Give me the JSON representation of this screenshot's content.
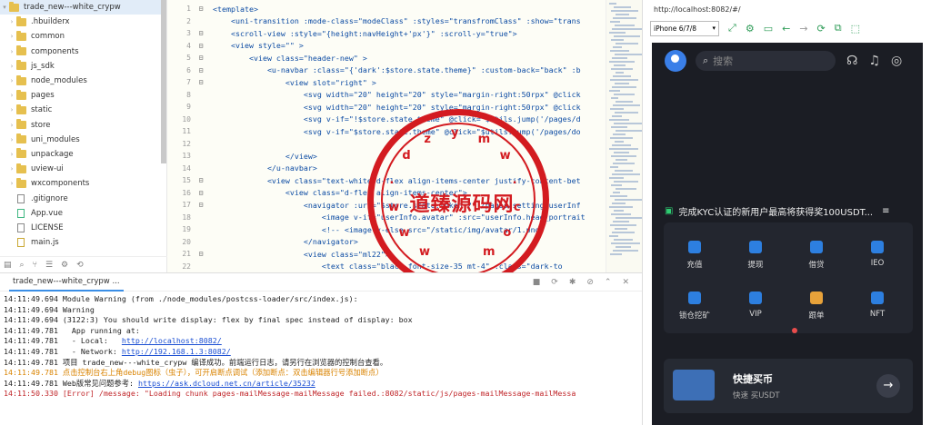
{
  "sidebar": {
    "project": "trade_new---white_crypw",
    "items": [
      {
        "name": ".hbuilderx",
        "type": "folder"
      },
      {
        "name": "common",
        "type": "folder"
      },
      {
        "name": "components",
        "type": "folder"
      },
      {
        "name": "js_sdk",
        "type": "folder"
      },
      {
        "name": "node_modules",
        "type": "folder"
      },
      {
        "name": "pages",
        "type": "folder"
      },
      {
        "name": "static",
        "type": "folder"
      },
      {
        "name": "store",
        "type": "folder"
      },
      {
        "name": "uni_modules",
        "type": "folder"
      },
      {
        "name": "unpackage",
        "type": "folder"
      },
      {
        "name": "uview-ui",
        "type": "folder"
      },
      {
        "name": "wxcomponents",
        "type": "folder"
      },
      {
        "name": ".gitignore",
        "type": "file"
      },
      {
        "name": "App.vue",
        "type": "file"
      },
      {
        "name": "LICENSE",
        "type": "file"
      },
      {
        "name": "main.js",
        "type": "file"
      }
    ]
  },
  "editor": {
    "lines": [
      {
        "n": "1",
        "f": "⊟",
        "t": "<template>"
      },
      {
        "n": "2",
        "f": "",
        "t": "    <uni-transition :mode-class=\"modeClass\" :styles=\"transfromClass\" :show=\"trans"
      },
      {
        "n": "3",
        "f": "⊟",
        "t": "    <scroll-view :style=\"{height:navHeight+'px'}\" :scroll-y=\"true\">"
      },
      {
        "n": "4",
        "f": "⊟",
        "t": "    <view style=\"\" >"
      },
      {
        "n": "5",
        "f": "⊟",
        "t": "        <view class=\"header-new\" >"
      },
      {
        "n": "6",
        "f": "⊟",
        "t": "            <u-navbar :class=\"{'dark':$store.state.theme}\" :custom-back=\"back\" :b"
      },
      {
        "n": "7",
        "f": "⊟",
        "t": "                <view slot=\"right\" >"
      },
      {
        "n": "8",
        "f": "",
        "t": "                    <svg width=\"20\" height=\"20\" style=\"margin-right:50rpx\" @click"
      },
      {
        "n": "9",
        "f": "",
        "t": "                    <svg width=\"20\" height=\"20\" style=\"margin-right:50rpx\" @click"
      },
      {
        "n": "10",
        "f": "",
        "t": "                    <svg v-if=\"!$store.state.theme\" @click=\"$utils.jump('/pages/d"
      },
      {
        "n": "11",
        "f": "",
        "t": "                    <svg v-if=\"$store.state.theme\" @click=\"$utils.jump('/pages/do"
      },
      {
        "n": "12",
        "f": "",
        "t": ""
      },
      {
        "n": "13",
        "f": "",
        "t": "                </view>"
      },
      {
        "n": "14",
        "f": "",
        "t": "            </u-navbar>"
      },
      {
        "n": "15",
        "f": "⊟",
        "t": "            <view class=\"text-white d-flex align-items-center justify-content-bet"
      },
      {
        "n": "16",
        "f": "⊟",
        "t": "                <view class=\"d-flex align-items-center\">"
      },
      {
        "n": "17",
        "f": "⊟",
        "t": "                    <navigator :url=\"$store.state.token ? '/pages/setting/userInf"
      },
      {
        "n": "18",
        "f": "",
        "t": "                        <image v-if=\"userInfo.avatar\" :src=\"userInfo.head_portrait"
      },
      {
        "n": "19",
        "f": "",
        "t": "                        <!-- <image v-else src=\"/static/img/avatar/1.png\""
      },
      {
        "n": "20",
        "f": "",
        "t": "                    </navigator>"
      },
      {
        "n": "21",
        "f": "⊟",
        "t": "                    <view class=\"ml22\">"
      },
      {
        "n": "22",
        "f": "",
        "t": "                        <text class=\"black font-size-35 mt-4\" :class=\"dark-to"
      }
    ]
  },
  "console": {
    "tab_label": "trade_new---white_crypw ...",
    "logs": [
      {
        "t": "14:11:49.694 Module Warning (from ./node_modules/postcss-loader/src/index.js):",
        "k": "n"
      },
      {
        "t": "14:11:49.694 Warning",
        "k": "n"
      },
      {
        "t": "14:11:49.694 (3122:3) You should write display: flex by final spec instead of display: box",
        "k": "n"
      },
      {
        "t": "14:11:49.781   App running at:",
        "k": "n"
      },
      {
        "t": "14:11:49.781   - Local:   ",
        "link": "http://localhost:8082/",
        "k": "l"
      },
      {
        "t": "14:11:49.781   - Network: ",
        "link": "http://192.168.1.3:8082/",
        "k": "l"
      },
      {
        "t": "14:11:49.781 项目 trade_new---white_crypw 编译成功。前端运行日志，请另行在浏览器的控制台查看。",
        "k": "n"
      },
      {
        "t": "14:11:49.781 点击控制台右上角debug图标（虫子），可开启断点调试（添加断点：双击编辑器行号添加断点）",
        "k": "w"
      },
      {
        "t": "14:11:49.781 Web版常见问题参考: ",
        "link": "https://ask.dcloud.net.cn/article/35232",
        "k": "l"
      },
      {
        "t": "14:11:50.330 [Error] /message: \"Loading chunk pages-mailMessage-mailMessage failed.:8082/static/js/pages-mailMessage-mailMessa",
        "k": "e"
      }
    ]
  },
  "stamp": {
    "text": "道臻源码网",
    "ring": "w w w . d z y m w . c o m"
  },
  "preview": {
    "url": "http://localhost:8082/#/",
    "device": "iPhone 6/7/8",
    "search_placeholder": "搜索",
    "notice": "完成KYC认证的新用户最高将获得奖100USDT...",
    "grid": [
      {
        "label": "充值"
      },
      {
        "label": "提现"
      },
      {
        "label": "借贷"
      },
      {
        "label": "IEO"
      },
      {
        "label": "锁仓挖矿"
      },
      {
        "label": "VIP"
      },
      {
        "label": "跟单"
      },
      {
        "label": "NFT"
      }
    ],
    "buy_title": "快捷买币",
    "buy_sub": "快速 买USDT"
  },
  "colors": {
    "stamp": "#d31b20",
    "accent": "#3a7fe8",
    "dark": "#1b1d24"
  }
}
